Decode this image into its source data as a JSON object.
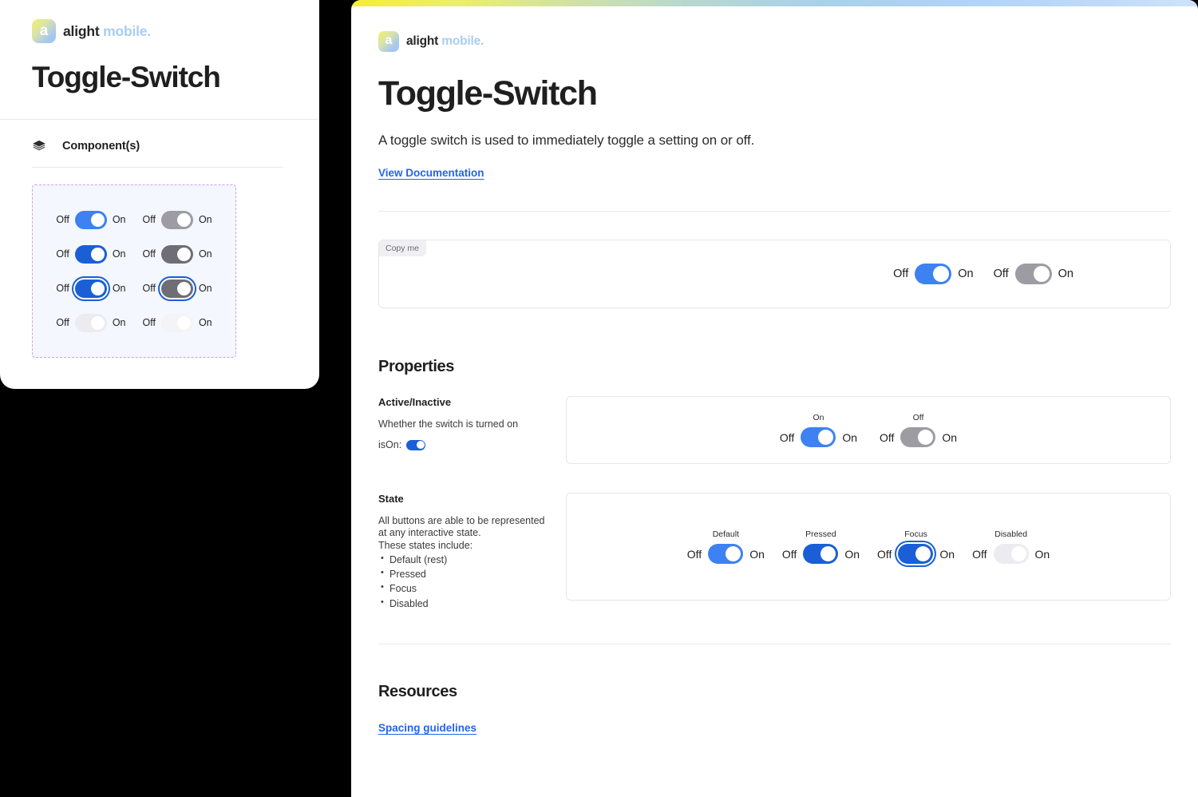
{
  "brand": {
    "logo_icon": "alight-logo-icon",
    "word_primary": "alight",
    "word_secondary": "mobile."
  },
  "left_panel": {
    "title": "Toggle-Switch",
    "section_icon": "layers-icon",
    "section_label": "Component(s)",
    "toggle_grid": {
      "rows": [
        {
          "state": "default",
          "left": {
            "off": "Off",
            "on": "On"
          },
          "right": {
            "off": "Off",
            "on": "On"
          }
        },
        {
          "state": "pressed",
          "left": {
            "off": "Off",
            "on": "On"
          },
          "right": {
            "off": "Off",
            "on": "On"
          }
        },
        {
          "state": "focus",
          "left": {
            "off": "Off",
            "on": "On"
          },
          "right": {
            "off": "Off",
            "on": "On"
          }
        },
        {
          "state": "disabled",
          "left": {
            "off": "Off",
            "on": "On"
          },
          "right": {
            "off": "Off",
            "on": "On"
          }
        }
      ]
    }
  },
  "right_panel": {
    "title": "Toggle-Switch",
    "description": "A toggle switch is used to immediately toggle a setting on or off.",
    "doc_link": "View Documentation",
    "preview": {
      "badge": "Copy me",
      "toggles": [
        {
          "state": "on-default",
          "off_label": "Off",
          "on_label": "On"
        },
        {
          "state": "off-default",
          "off_label": "Off",
          "on_label": "On"
        }
      ]
    },
    "properties": {
      "heading": "Properties",
      "rows": [
        {
          "name": "Active/Inactive",
          "description": "Whether the switch is turned on",
          "extra_label": "isOn:",
          "extra_toggle": true,
          "bullets": [],
          "examples": [
            {
              "label": "On",
              "state": "on-default",
              "off_label": "Off",
              "on_label": "On"
            },
            {
              "label": "Off",
              "state": "off-default",
              "off_label": "Off",
              "on_label": "On"
            }
          ]
        },
        {
          "name": "State",
          "description": "All buttons are able to be represented at any interactive state.\nThese states include:",
          "extra_label": "",
          "extra_toggle": false,
          "bullets": [
            "Default (rest)",
            "Pressed",
            "Focus",
            "Disabled"
          ],
          "examples": [
            {
              "label": "Default",
              "state": "on-default",
              "off_label": "Off",
              "on_label": "On"
            },
            {
              "label": "Pressed",
              "state": "on-pressed",
              "off_label": "Off",
              "on_label": "On"
            },
            {
              "label": "Focus",
              "state": "on-focus",
              "off_label": "Off",
              "on_label": "On"
            },
            {
              "label": "Disabled",
              "state": "on-disabled",
              "off_label": "Off",
              "on_label": "On"
            }
          ]
        }
      ]
    },
    "resources": {
      "heading": "Resources",
      "link": "Spacing guidelines"
    }
  },
  "colors": {
    "accent_blue": "#2563eb",
    "toggle_on_default": "#3d81f2",
    "toggle_on_pressed": "#1a5fd6",
    "toggle_off_default": "#9c9ca2",
    "toggle_off_pressed": "#6e6e74",
    "toggle_disabled": "#ececf0",
    "dashed_border": "#cf9ef2",
    "dashed_fill": "#f4f7fd",
    "gradient_start": "#f6ee30",
    "gradient_end": "#cfe3fb"
  }
}
